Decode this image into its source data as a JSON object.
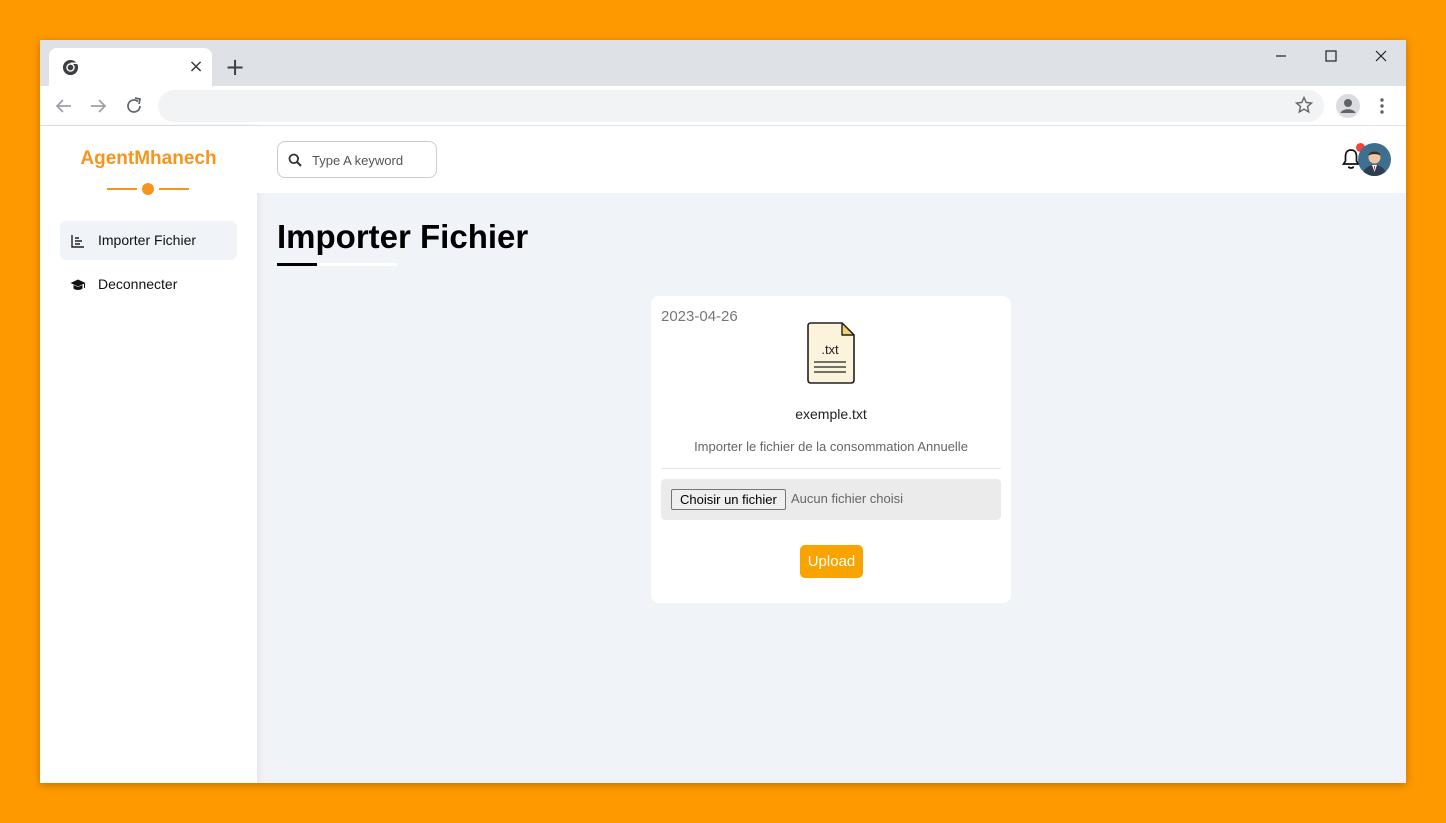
{
  "browser": {
    "tab_title": "",
    "tab_close_icon": "×",
    "new_tab_icon": "+",
    "address": ""
  },
  "app": {
    "brand": "AgentMhanech",
    "accent_color": "#f7941d",
    "sidebar": {
      "items": [
        {
          "label": "Importer Fichier",
          "icon": "chart-bars-icon",
          "active": true
        },
        {
          "label": "Deconnecter",
          "icon": "graduation-cap-icon",
          "active": false
        }
      ]
    },
    "search": {
      "placeholder": "Type A keyword",
      "value": ""
    },
    "notifications": {
      "has_unread": true
    }
  },
  "page": {
    "title": "Importer Fichier",
    "card": {
      "date": "2023-04-26",
      "file_icon_label": ".txt",
      "file_name": "exemple.txt",
      "description": "Importer le fichier de la consommation Annuelle",
      "choose_label": "Choisir un fichier",
      "no_file_label": "Aucun fichier choisi",
      "upload_label": "Upload",
      "upload_color": "#f7a400"
    }
  }
}
